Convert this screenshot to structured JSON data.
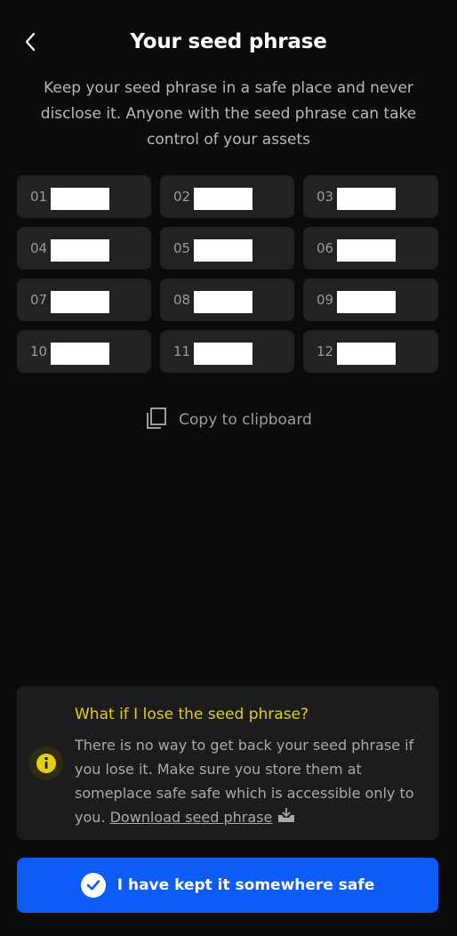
{
  "header": {
    "back_icon": "chevron-left-icon",
    "title": "Your seed phrase"
  },
  "subtitle": "Keep your seed phrase in a safe place and never disclose it. Anyone with the seed phrase can take control of your assets",
  "seed_words": [
    {
      "num": "01"
    },
    {
      "num": "02"
    },
    {
      "num": "03"
    },
    {
      "num": "04"
    },
    {
      "num": "05"
    },
    {
      "num": "06"
    },
    {
      "num": "07"
    },
    {
      "num": "08"
    },
    {
      "num": "09"
    },
    {
      "num": "10"
    },
    {
      "num": "11"
    },
    {
      "num": "12"
    }
  ],
  "copy": {
    "icon": "copy-icon",
    "label": "Copy to clipboard"
  },
  "info": {
    "icon": "info-icon",
    "title": "What if I lose the seed phrase?",
    "body": "There is no way to get back your seed phrase if you lose it. Make sure you store them at someplace safe safe which is accessible only to you. ",
    "link_label": "Download seed phrase",
    "link_icon": "download-icon"
  },
  "confirm_button": {
    "icon": "check-circle-icon",
    "label": "I have kept it somewhere safe"
  },
  "colors": {
    "background": "#0b0b0b",
    "cell": "#222222",
    "accent_blue": "#0d5cf8",
    "warning_yellow": "#e4cd13"
  }
}
